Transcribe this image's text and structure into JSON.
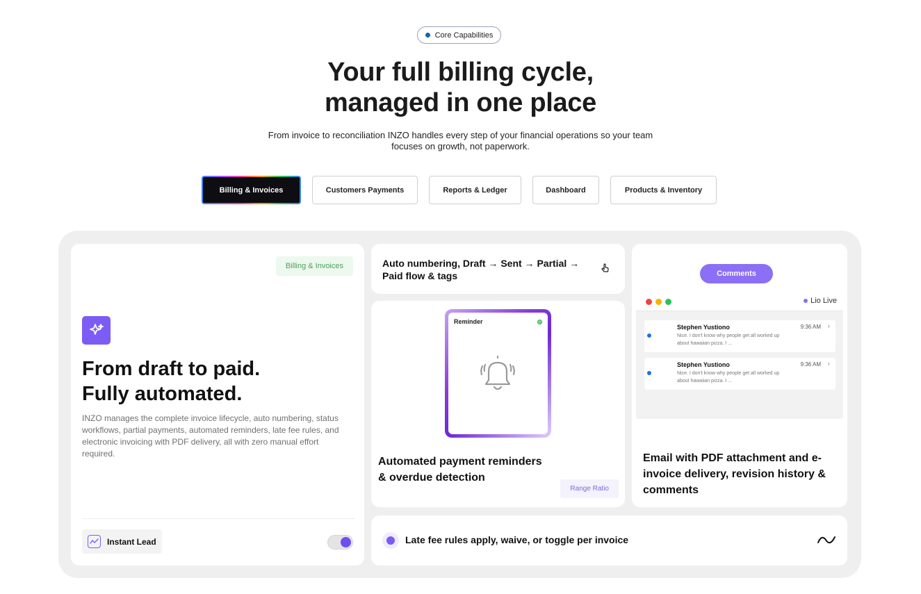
{
  "badge": {
    "label": "Core Capabilities"
  },
  "hero": {
    "title_line1": "Your full billing cycle,",
    "title_line2": "managed in one place",
    "subtitle": "From invoice to reconciliation INZO handles every step of your financial operations so your team focuses on growth, not paperwork."
  },
  "tabs": [
    {
      "label": "Billing & Invoices",
      "active": true
    },
    {
      "label": "Customers Payments",
      "active": false
    },
    {
      "label": "Reports & Ledger",
      "active": false
    },
    {
      "label": "Dashboard",
      "active": false
    },
    {
      "label": "Products & Inventory",
      "active": false
    }
  ],
  "main_card": {
    "tag": "Billing & Invoices",
    "icon": "sparkle-icon",
    "title_line1": "From draft to paid.",
    "title_line2": "Fully automated.",
    "description": "INZO manages the complete invoice lifecycle, auto numbering, status workflows, partial payments, automated reminders, late fee rules, and electronic invoicing with PDF delivery, all with zero manual effort required.",
    "footer_label": "Instant Lead",
    "footer_icon": "chart-line-icon",
    "toggle_on": true
  },
  "flow_card": {
    "text": "Auto numbering, Draft → Sent → Partial → Paid flow & tags",
    "icon": "cursor-click-icon"
  },
  "reminder_card": {
    "widget_label": "Reminder",
    "icon": "bell-ringing-icon",
    "title": "Automated payment reminders & overdue detection",
    "tag": "Range Ratio"
  },
  "comments_card": {
    "button": "Comments",
    "live_label": "Lio Live",
    "messages": [
      {
        "name": "Stephen Yustiono",
        "time": "9:36 AM",
        "preview": "Nice. I don't know why people get all worked up about hawaiian pizza. I ..."
      },
      {
        "name": "Stephen Yustiono",
        "time": "9:36 AM",
        "preview": "Nice. I don't know why people get all worked up about hawaiian pizza. I ..."
      }
    ],
    "title": "Email with PDF attachment and e-invoice delivery, revision history & comments"
  },
  "late_fee_card": {
    "text": "Late fee rules apply, waive, or toggle per invoice",
    "icon": "wave-icon"
  },
  "colors": {
    "accent": "#7c5cf5",
    "green_tag": "#4aa25a",
    "dark": "#0d0d12"
  }
}
